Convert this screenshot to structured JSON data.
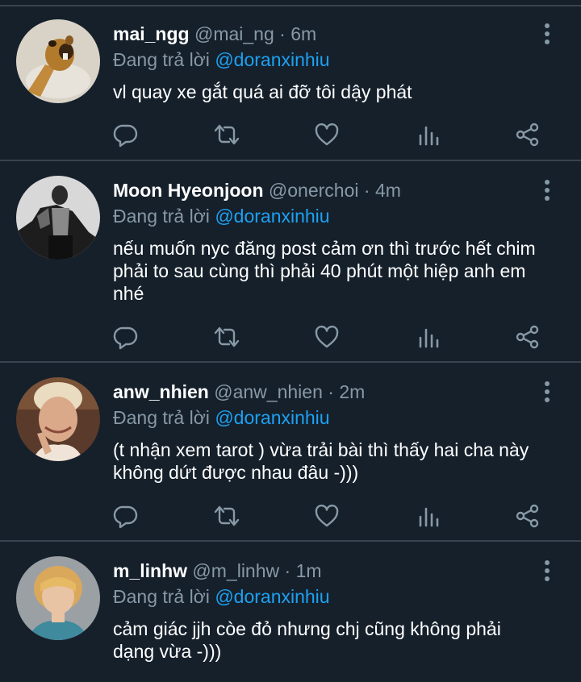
{
  "colors": {
    "background": "#15202b",
    "divider": "#38444d",
    "secondary_text": "#8899a6",
    "mention": "#1da1f2",
    "icon": "#8899a6"
  },
  "icons": {
    "reply": "speech-bubble-icon",
    "retweet": "retweet-arrows-icon",
    "like": "heart-icon",
    "analytics": "bar-chart-icon",
    "share": "share-icon",
    "more": "vertical-dots-icon"
  },
  "tweets": [
    {
      "display_name": "mai_ngg",
      "handle": "@mai_ng",
      "separator": "·",
      "time": "6m",
      "replying_prefix": "Đang trả lời",
      "replying_to": "@doranxinhiu",
      "text": "vl quay xe gắt quá ai đỡ tôi dậy phát"
    },
    {
      "display_name": "Moon Hyeonjoon",
      "handle": "@onerchoi",
      "separator": "·",
      "time": "4m",
      "replying_prefix": "Đang trả lời",
      "replying_to": "@doranxinhiu",
      "text": "nếu muốn nyc đăng post cảm ơn thì trước hết chim\nphải to sau cùng thì phải 40 phút một hiệp anh em\nnhé"
    },
    {
      "display_name": "anw_nhien",
      "handle": "@anw_nhien",
      "separator": "·",
      "time": "2m",
      "replying_prefix": "Đang trả lời",
      "replying_to": "@doranxinhiu",
      "text": "(t nhận xem tarot ) vừa trải bài thì thấy hai cha này\nkhông dứt được nhau đâu -)))"
    },
    {
      "display_name": "m_linhw",
      "handle": "@m_linhw",
      "separator": "·",
      "time": "1m",
      "replying_prefix": "Đang trả lời",
      "replying_to": "@doranxinhiu",
      "text": "cảm giác jjh còe đỏ nhưng chj cũng không phải\ndạng vừa -)))"
    }
  ]
}
